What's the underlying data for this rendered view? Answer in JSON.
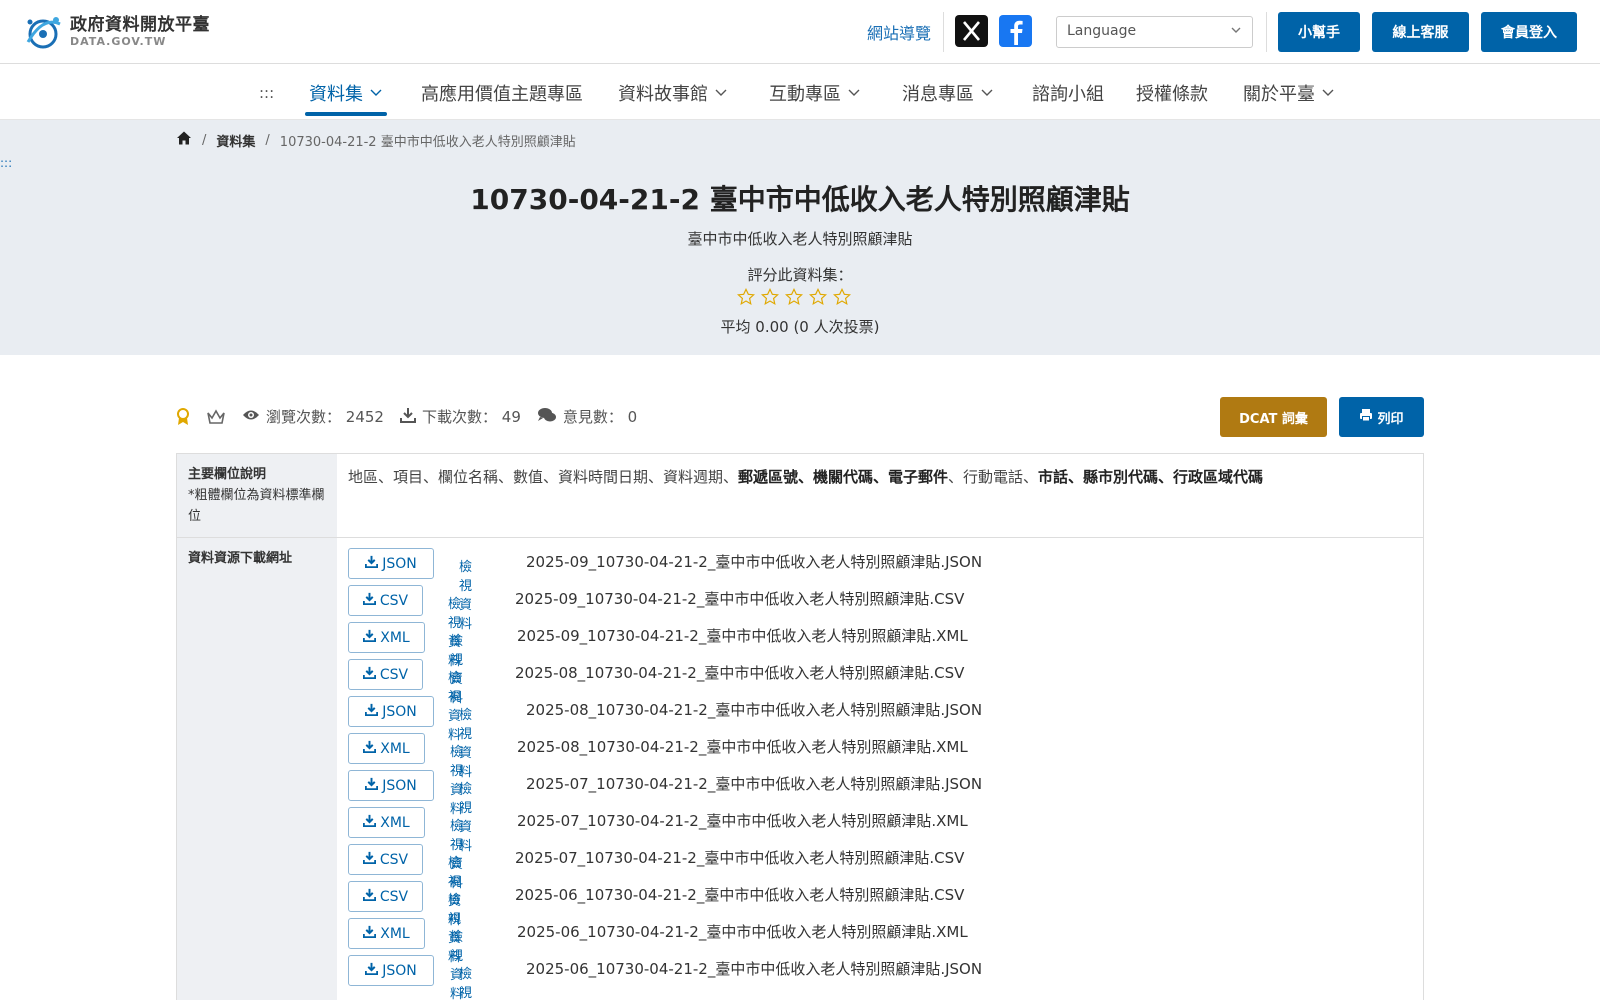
{
  "header": {
    "logo_title": "政府資料開放平臺",
    "logo_sub": "DATA.GOV.TW",
    "sitemap": "網站導覽",
    "language_placeholder": "Language",
    "helper": "小幫手",
    "support": "線上客服",
    "login": "會員登入",
    "colors": {
      "primary": "#0063a8",
      "dcat": "#b07a12"
    }
  },
  "nav": {
    "accesskey": ":::",
    "items": [
      {
        "label": "資料集",
        "dropdown": true
      },
      {
        "label": "高應用價值主題專區",
        "dropdown": false
      },
      {
        "label": "資料故事館",
        "dropdown": true
      },
      {
        "label": "互動專區",
        "dropdown": true
      },
      {
        "label": "消息專區",
        "dropdown": true
      },
      {
        "label": "諮詢小組",
        "dropdown": false
      },
      {
        "label": "授權條款",
        "dropdown": false
      },
      {
        "label": "關於平臺",
        "dropdown": true
      }
    ]
  },
  "breadcrumb": {
    "level1": "資料集",
    "current": "10730-04-21-2 臺中市中低收入老人特別照顧津貼"
  },
  "hero": {
    "accesskey": ":::",
    "title": "10730-04-21-2 臺中市中低收入老人特別照顧津貼",
    "subtitle": "臺中市中低收入老人特別照顧津貼",
    "rate_label": "評分此資料集：",
    "stars": 5,
    "average": "平均 0.00 (0 人次投票)"
  },
  "stats": {
    "views_label": "瀏覽次數：",
    "views": "2452",
    "downloads_label": "下載次數：",
    "downloads": "49",
    "comments_label": "意見數：",
    "comments": "0",
    "dcat": "DCAT 詞彙",
    "print": "列印"
  },
  "table": {
    "fields_header": "主要欄位說明",
    "fields_note": "*粗體欄位為資料標準欄位",
    "fields_normal_1": "地區、項目、欄位名稱、數值、資料時間日期、資料週期、",
    "fields_bold_1": "郵遞區號、機關代碼、電子郵件",
    "fields_normal_2": "、行動電話、",
    "fields_bold_2": "市話、縣市別代碼、行政區域代碼",
    "resources_header": "資料資源下載網址",
    "view_label": "檢視資料",
    "resources": [
      {
        "format": "JSON",
        "file": "2025-09_10730-04-21-2_臺中市中低收入老人特別照顧津貼.JSON"
      },
      {
        "format": "CSV",
        "file": "2025-09_10730-04-21-2_臺中市中低收入老人特別照顧津貼.CSV"
      },
      {
        "format": "XML",
        "file": "2025-09_10730-04-21-2_臺中市中低收入老人特別照顧津貼.XML"
      },
      {
        "format": "CSV",
        "file": "2025-08_10730-04-21-2_臺中市中低收入老人特別照顧津貼.CSV"
      },
      {
        "format": "JSON",
        "file": "2025-08_10730-04-21-2_臺中市中低收入老人特別照顧津貼.JSON"
      },
      {
        "format": "XML",
        "file": "2025-08_10730-04-21-2_臺中市中低收入老人特別照顧津貼.XML"
      },
      {
        "format": "JSON",
        "file": "2025-07_10730-04-21-2_臺中市中低收入老人特別照顧津貼.JSON"
      },
      {
        "format": "XML",
        "file": "2025-07_10730-04-21-2_臺中市中低收入老人特別照顧津貼.XML"
      },
      {
        "format": "CSV",
        "file": "2025-07_10730-04-21-2_臺中市中低收入老人特別照顧津貼.CSV"
      },
      {
        "format": "CSV",
        "file": "2025-06_10730-04-21-2_臺中市中低收入老人特別照顧津貼.CSV"
      },
      {
        "format": "XML",
        "file": "2025-06_10730-04-21-2_臺中市中低收入老人特別照顧津貼.XML"
      },
      {
        "format": "JSON",
        "file": "2025-06_10730-04-21-2_臺中市中低收入老人特別照顧津貼.JSON"
      }
    ]
  }
}
